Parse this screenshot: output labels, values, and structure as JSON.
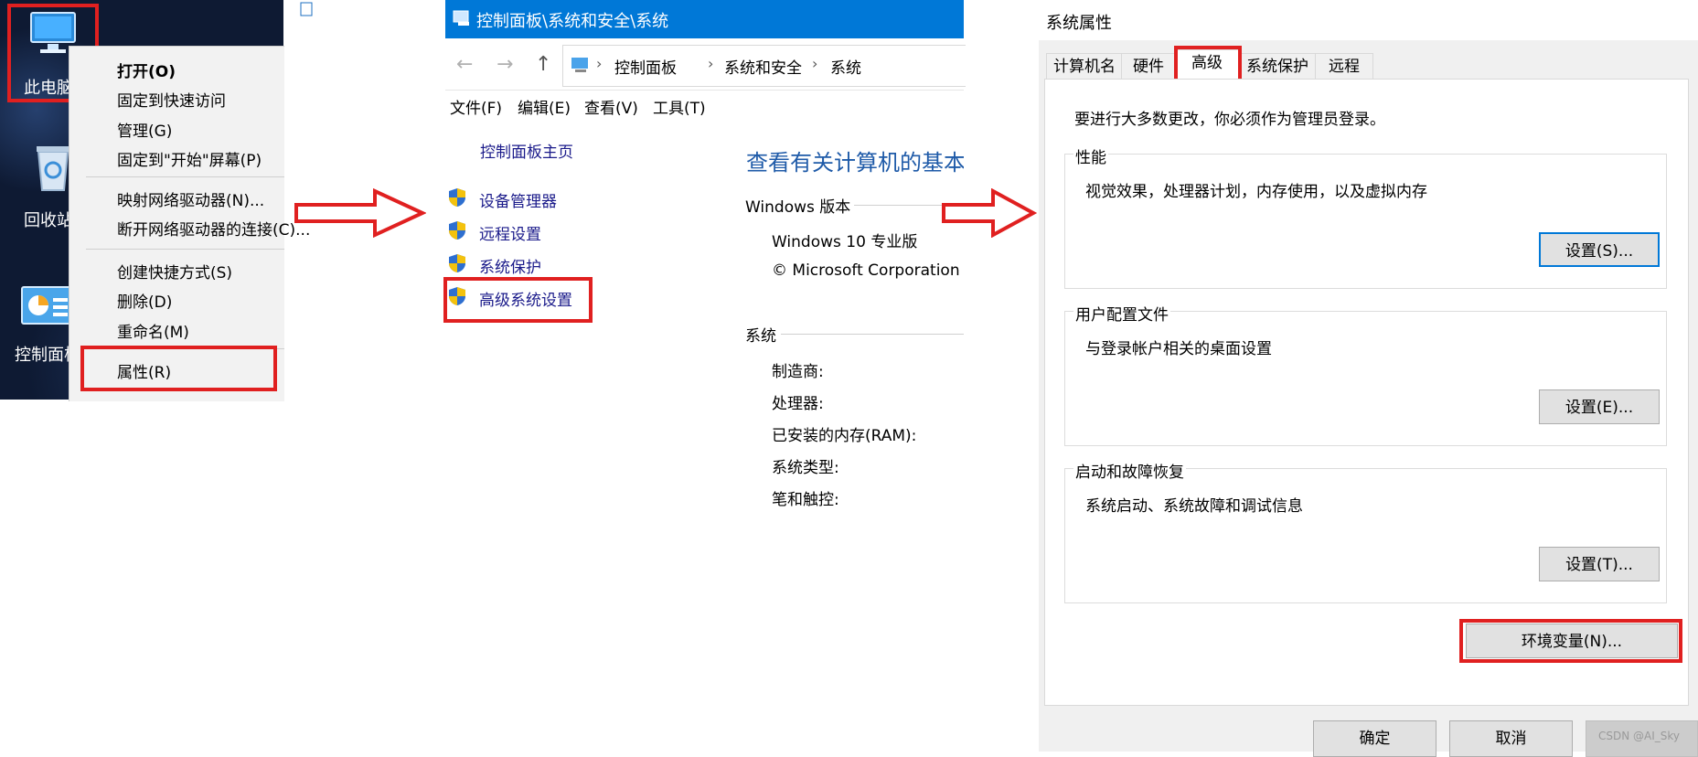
{
  "desktop": {
    "icons": [
      {
        "label": "此电脑"
      },
      {
        "label": "回收站"
      },
      {
        "label": "控制面板"
      }
    ],
    "context_menu": {
      "items": [
        {
          "label": "打开(O)",
          "bold": true
        },
        {
          "label": "固定到快速访问"
        },
        {
          "label": "管理(G)"
        },
        {
          "label": "固定到\"开始\"屏幕(P)"
        },
        {
          "label": "映射网络驱动器(N)..."
        },
        {
          "label": "断开网络驱动器的连接(C)..."
        },
        {
          "label": "创建快捷方式(S)"
        },
        {
          "label": "删除(D)"
        },
        {
          "label": "重命名(M)"
        },
        {
          "label": "属性(R)"
        }
      ]
    }
  },
  "control_panel": {
    "title": "控制面板\\系统和安全\\系统",
    "breadcrumb": [
      "控制面板",
      "系统和安全",
      "系统"
    ],
    "menu": [
      "文件(F)",
      "编辑(E)",
      "查看(V)",
      "工具(T)"
    ],
    "home_link": "控制面板主页",
    "links": [
      "设备管理器",
      "远程设置",
      "系统保护",
      "高级系统设置"
    ],
    "heading": "查看有关计算机的基本",
    "windows_version_label": "Windows 版本",
    "edition": "Windows 10 专业版",
    "copyright": "© Microsoft Corporation",
    "system_label": "系统",
    "system_fields": [
      "制造商:",
      "处理器:",
      "已安装的内存(RAM):",
      "系统类型:",
      "笔和触控:"
    ]
  },
  "system_properties": {
    "title": "系统属性",
    "tabs": [
      "计算机名",
      "硬件",
      "高级",
      "系统保护",
      "远程"
    ],
    "active_tab": "高级",
    "admin_note": "要进行大多数更改，你必须作为管理员登录。",
    "groups": [
      {
        "legend": "性能",
        "desc": "视觉效果，处理器计划，内存使用，以及虚拟内存",
        "button": "设置(S)..."
      },
      {
        "legend": "用户配置文件",
        "desc": "与登录帐户相关的桌面设置",
        "button": "设置(E)..."
      },
      {
        "legend": "启动和故障恢复",
        "desc": "系统启动、系统故障和调试信息",
        "button": "设置(T)..."
      }
    ],
    "env_button": "环境变量(N)...",
    "ok_button": "确定",
    "cancel_button": "取消",
    "watermark": "CSDN @AI_Sky"
  },
  "colors": {
    "highlight": "#e02020",
    "accent": "#0078d7"
  }
}
